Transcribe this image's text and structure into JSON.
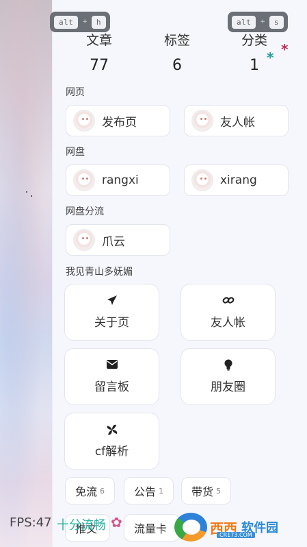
{
  "shortcuts": {
    "left": {
      "key1": "alt",
      "plus": "+",
      "key2": "h"
    },
    "right": {
      "key1": "alt",
      "plus": "+",
      "key2": "s"
    }
  },
  "stats": {
    "articles": {
      "label": "文章",
      "value": "77"
    },
    "tags": {
      "label": "标签",
      "value": "6"
    },
    "categories": {
      "label": "分类",
      "value": "1"
    }
  },
  "decorations": {
    "star_teal": "*",
    "star_red": "*"
  },
  "sections": {
    "web": {
      "title": "网页",
      "links": [
        {
          "label": "发布页"
        },
        {
          "label": "友人帐"
        }
      ]
    },
    "netdisk": {
      "title": "网盘",
      "links": [
        {
          "label": "rangxi"
        },
        {
          "label": "xirang"
        }
      ]
    },
    "netdisk_split": {
      "title": "网盘分流",
      "links": [
        {
          "label": "爪云"
        }
      ]
    },
    "mountains": {
      "title": "我见青山多妩媚",
      "cards": [
        {
          "label": "关于页",
          "icon": "paper-plane-icon"
        },
        {
          "label": "友人帐",
          "icon": "link-icon"
        },
        {
          "label": "留言板",
          "icon": "envelope-icon"
        },
        {
          "label": "朋友圈",
          "icon": "lightbulb-icon"
        },
        {
          "label": "cf解析",
          "icon": "fan-icon"
        }
      ]
    }
  },
  "tags": [
    {
      "label": "免流",
      "count": "6"
    },
    {
      "label": "公告",
      "count": "1"
    },
    {
      "label": "带货",
      "count": "5"
    },
    {
      "label": "推文",
      "count": ""
    },
    {
      "label": "流量卡",
      "count": ""
    }
  ],
  "status": {
    "fps": "FPS:47",
    "fluency": "十分流畅",
    "flower": "✿"
  },
  "watermark": {
    "name": "西西",
    "name2": "软件园",
    "url": "CR173.COM"
  },
  "colors": {
    "teal": "#2bb3a5",
    "red_star": "#c0305a"
  }
}
